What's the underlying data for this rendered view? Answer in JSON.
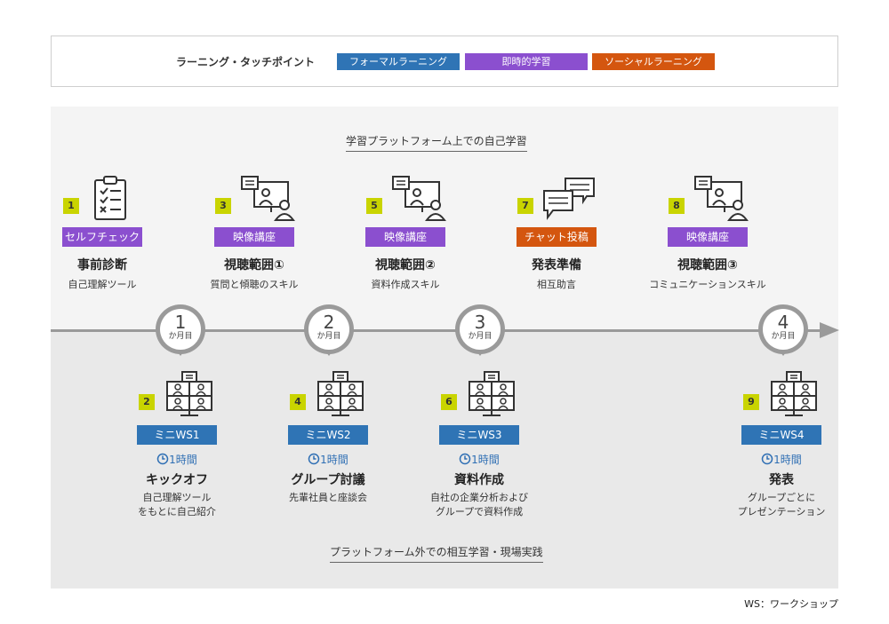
{
  "legend": {
    "title": "ラーニング・タッチポイント",
    "tags": [
      {
        "label": "フォーマルラーニング",
        "color": "#2f74b5"
      },
      {
        "label": "即時的学習",
        "color": "#8b4fcf"
      },
      {
        "label": "ソーシャルラーニング",
        "color": "#d4560f"
      }
    ]
  },
  "sections": {
    "top_title": "学習プラットフォーム上での自己学習",
    "bottom_title": "プラットフォーム外での相互学習・現場実践"
  },
  "months": [
    {
      "num": "1",
      "label": "か月目"
    },
    {
      "num": "2",
      "label": "か月目"
    },
    {
      "num": "3",
      "label": "か月目"
    },
    {
      "num": "4",
      "label": "か月目"
    }
  ],
  "top_items": [
    {
      "step": "1",
      "tag": "セルフチェック",
      "tag_color": "#8b4fcf",
      "title": "事前診断",
      "sub": "自己理解ツール",
      "icon": "clipboard-checklist-icon"
    },
    {
      "step": "3",
      "tag": "映像講座",
      "tag_color": "#8b4fcf",
      "title": "視聴範囲①",
      "sub": "質問と傾聴のスキル",
      "icon": "video-lecture-icon"
    },
    {
      "step": "5",
      "tag": "映像講座",
      "tag_color": "#8b4fcf",
      "title": "視聴範囲②",
      "sub": "資料作成スキル",
      "icon": "video-lecture-icon"
    },
    {
      "step": "7",
      "tag": "チャット投稿",
      "tag_color": "#d4560f",
      "title": "発表準備",
      "sub": "相互助言",
      "icon": "chat-bubbles-icon"
    },
    {
      "step": "8",
      "tag": "映像講座",
      "tag_color": "#8b4fcf",
      "title": "視聴範囲③",
      "sub": "コミュニケーションスキル",
      "icon": "video-lecture-icon"
    }
  ],
  "bottom_items": [
    {
      "step": "2",
      "tag": "ミニWS1",
      "tag_color": "#2f74b5",
      "duration": "1時間",
      "title": "キックオフ",
      "sub1": "自己理解ツール",
      "sub2": "をもとに自己紹介",
      "icon": "online-meeting-icon"
    },
    {
      "step": "4",
      "tag": "ミニWS2",
      "tag_color": "#2f74b5",
      "duration": "1時間",
      "title": "グループ討議",
      "sub1": "先輩社員と座談会",
      "sub2": "",
      "icon": "online-meeting-icon"
    },
    {
      "step": "6",
      "tag": "ミニWS3",
      "tag_color": "#2f74b5",
      "duration": "1時間",
      "title": "資料作成",
      "sub1": "自社の企業分析および",
      "sub2": "グループで資料作成",
      "icon": "online-meeting-icon"
    },
    {
      "step": "9",
      "tag": "ミニWS4",
      "tag_color": "#2f74b5",
      "duration": "1時間",
      "title": "発表",
      "sub1": "グループごとに",
      "sub2": "プレゼンテーション",
      "icon": "online-meeting-icon"
    }
  ],
  "footnote": "WS：ワークショップ"
}
